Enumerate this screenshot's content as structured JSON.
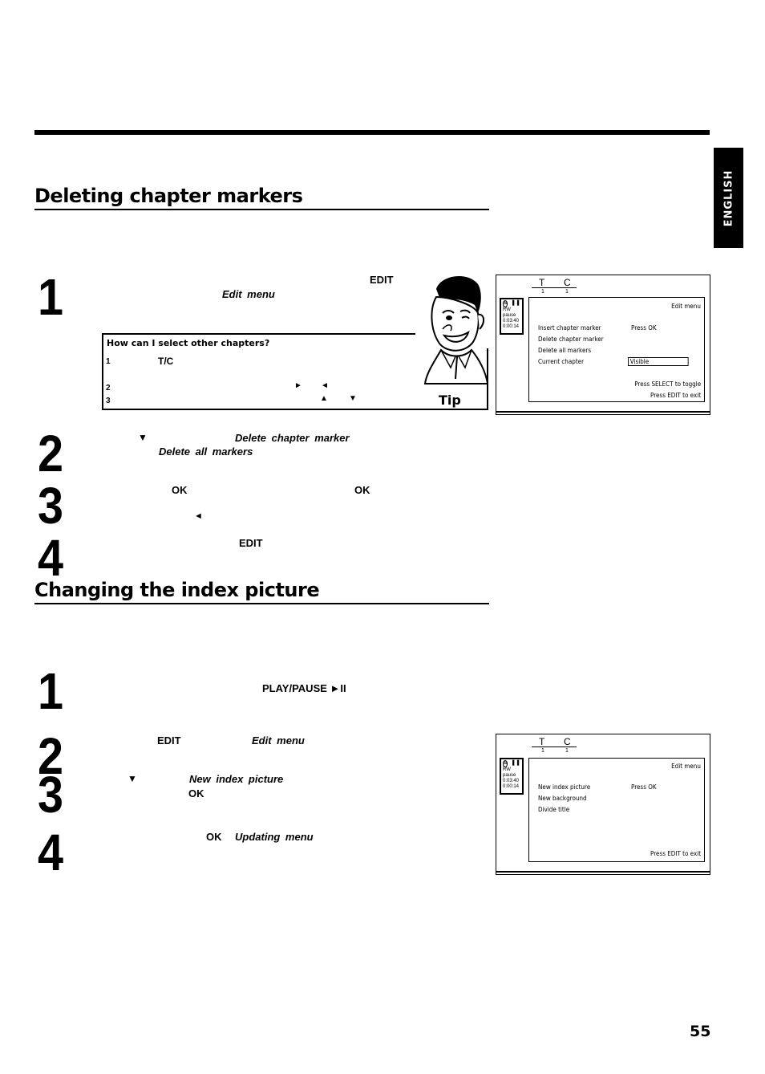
{
  "page": {
    "language_tab": "ENGLISH",
    "page_number": "55"
  },
  "section1": {
    "title": "Deleting chapter markers",
    "steps": [
      {
        "number": "1",
        "keyword": "EDIT",
        "emphasis": "Edit menu"
      },
      {
        "number": "2",
        "arrow": "▼",
        "emphasis1": "Delete chapter marker",
        "emphasis2": "Delete all markers"
      },
      {
        "number": "3",
        "keyword1": "OK",
        "keyword2": "OK",
        "arrow": "◄"
      },
      {
        "number": "4",
        "keyword": "EDIT"
      }
    ],
    "tip": {
      "title": "How can I select other chapters?",
      "label": "Tip",
      "items": [
        {
          "n": "1",
          "keyword": "T/C"
        },
        {
          "n": "2",
          "arrow1": "►",
          "arrow2": "◄"
        },
        {
          "n": "3",
          "arrow1": "▲",
          "arrow2": "▼"
        }
      ]
    },
    "screen": {
      "t_label": "T",
      "c_label": "C",
      "t_value": "1",
      "c_value": "1",
      "status": {
        "disc": "S",
        "pause_icon": "❚❚",
        "mode": "RW",
        "state": "pause",
        "time1": "0:03:40",
        "time2": "0:00:14"
      },
      "menu_title": "Edit menu",
      "items": [
        {
          "label": "Insert chapter marker",
          "value": "Press OK"
        },
        {
          "label": "Delete chapter marker",
          "value": ""
        },
        {
          "label": "Delete all markers",
          "value": ""
        },
        {
          "label": "Current chapter",
          "value": "Visible"
        }
      ],
      "hint1": "Press SELECT to toggle",
      "hint2": "Press EDIT to exit"
    }
  },
  "section2": {
    "title": "Changing the index picture",
    "steps": [
      {
        "number": "1",
        "keyword": "PLAY/PAUSE ►II"
      },
      {
        "number": "2",
        "keyword": "EDIT",
        "emphasis": "Edit menu"
      },
      {
        "number": "3",
        "arrow": "▼",
        "emphasis": "New index picture",
        "keyword": "OK"
      },
      {
        "number": "4",
        "keyword": "OK",
        "emphasis": "Updating menu"
      }
    ],
    "screen": {
      "t_label": "T",
      "c_label": "C",
      "t_value": "1",
      "c_value": "1",
      "status": {
        "disc": "S",
        "pause_icon": "❚❚",
        "mode": "RW",
        "state": "pause",
        "time1": "0:03:40",
        "time2": "0:00:14"
      },
      "menu_title": "Edit menu",
      "items": [
        {
          "label": "New index picture",
          "value": "Press OK"
        },
        {
          "label": "New background",
          "value": ""
        },
        {
          "label": "Divide title",
          "value": ""
        }
      ],
      "hint": "Press EDIT to exit"
    }
  }
}
